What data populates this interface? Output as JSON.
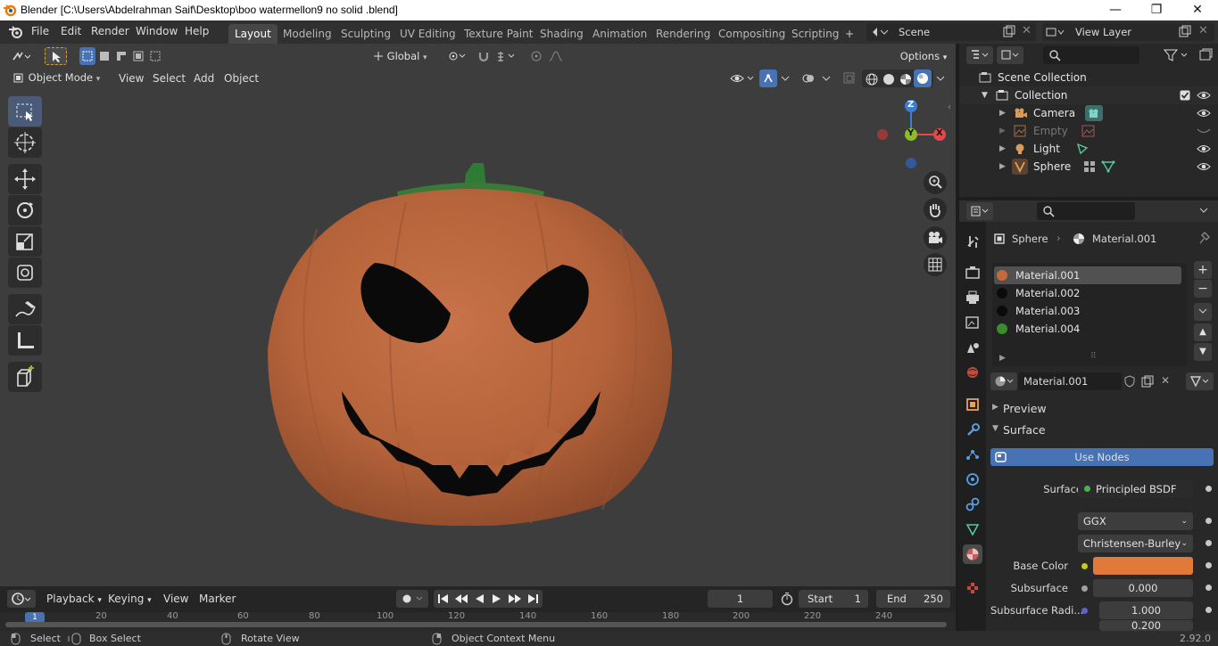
{
  "window": {
    "title": "Blender [C:\\Users\\Abdelrahman Saif\\Desktop\\boo watermellon9 no solid .blend]",
    "minimize": "—",
    "maximize": "❐",
    "close": "✕"
  },
  "menu": [
    "File",
    "Edit",
    "Render",
    "Window",
    "Help"
  ],
  "workspaces": [
    "Layout",
    "Modeling",
    "Sculpting",
    "UV Editing",
    "Texture Paint",
    "Shading",
    "Animation",
    "Rendering",
    "Compositing",
    "Scripting"
  ],
  "active_workspace": "Layout",
  "add_workspace": "+",
  "scene": {
    "label": "Scene",
    "view_layer": "View Layer"
  },
  "viewport": {
    "mode": "Object Mode",
    "menus": [
      "View",
      "Select",
      "Add",
      "Object"
    ],
    "transform_orientation": "Global",
    "options": "Options",
    "gizmo": {
      "z": "Z",
      "y": "Y",
      "x": "X"
    }
  },
  "timeline": {
    "menus": [
      "Playback",
      "Keying",
      "View",
      "Marker"
    ],
    "current_frame": "1",
    "start_label": "Start",
    "start": "1",
    "end_label": "End",
    "end": "250",
    "ruler": [
      "1",
      "20",
      "40",
      "60",
      "80",
      "100",
      "120",
      "140",
      "160",
      "180",
      "200",
      "220",
      "240"
    ]
  },
  "statusbar": {
    "select": "Select",
    "box_select": "Box Select",
    "rotate_view": "Rotate View",
    "context_menu": "Object Context Menu",
    "version": "2.92.0"
  },
  "outliner": {
    "scene_collection": "Scene Collection",
    "collection": "Collection",
    "items": [
      {
        "name": "Camera",
        "dim": false
      },
      {
        "name": "Empty",
        "dim": true
      },
      {
        "name": "Light",
        "dim": false
      },
      {
        "name": "Sphere",
        "dim": false
      }
    ]
  },
  "properties": {
    "breadcrumb": {
      "object": "Sphere",
      "material": "Material.001"
    },
    "materials": [
      {
        "name": "Material.001",
        "color": "#c46a3a"
      },
      {
        "name": "Material.002",
        "color": "#0b0b0b"
      },
      {
        "name": "Material.003",
        "color": "#0b0b0b"
      },
      {
        "name": "Material.004",
        "color": "#3c8c2e"
      }
    ],
    "active_material": "Material.001",
    "panels": {
      "preview": "Preview",
      "surface": "Surface"
    },
    "use_nodes": "Use Nodes",
    "surface_label": "Surface",
    "surface_value": "Principled BSDF",
    "distribution": "GGX",
    "subsurface_method": "Christensen-Burley",
    "base_color_label": "Base Color",
    "base_color": "#e07a3a",
    "subsurface_label": "Subsurface",
    "subsurface_value": "0.000",
    "subsurface_radius_label": "Subsurface Radi...",
    "subsurface_radius_1": "1.000",
    "subsurface_radius_2": "0.200"
  },
  "colors": {
    "accent": "#4772b3",
    "axis_x": "#e04a4a",
    "axis_y": "#8bbd2a",
    "axis_z": "#3c7ed6",
    "pumpkin": "#c06a3c"
  }
}
